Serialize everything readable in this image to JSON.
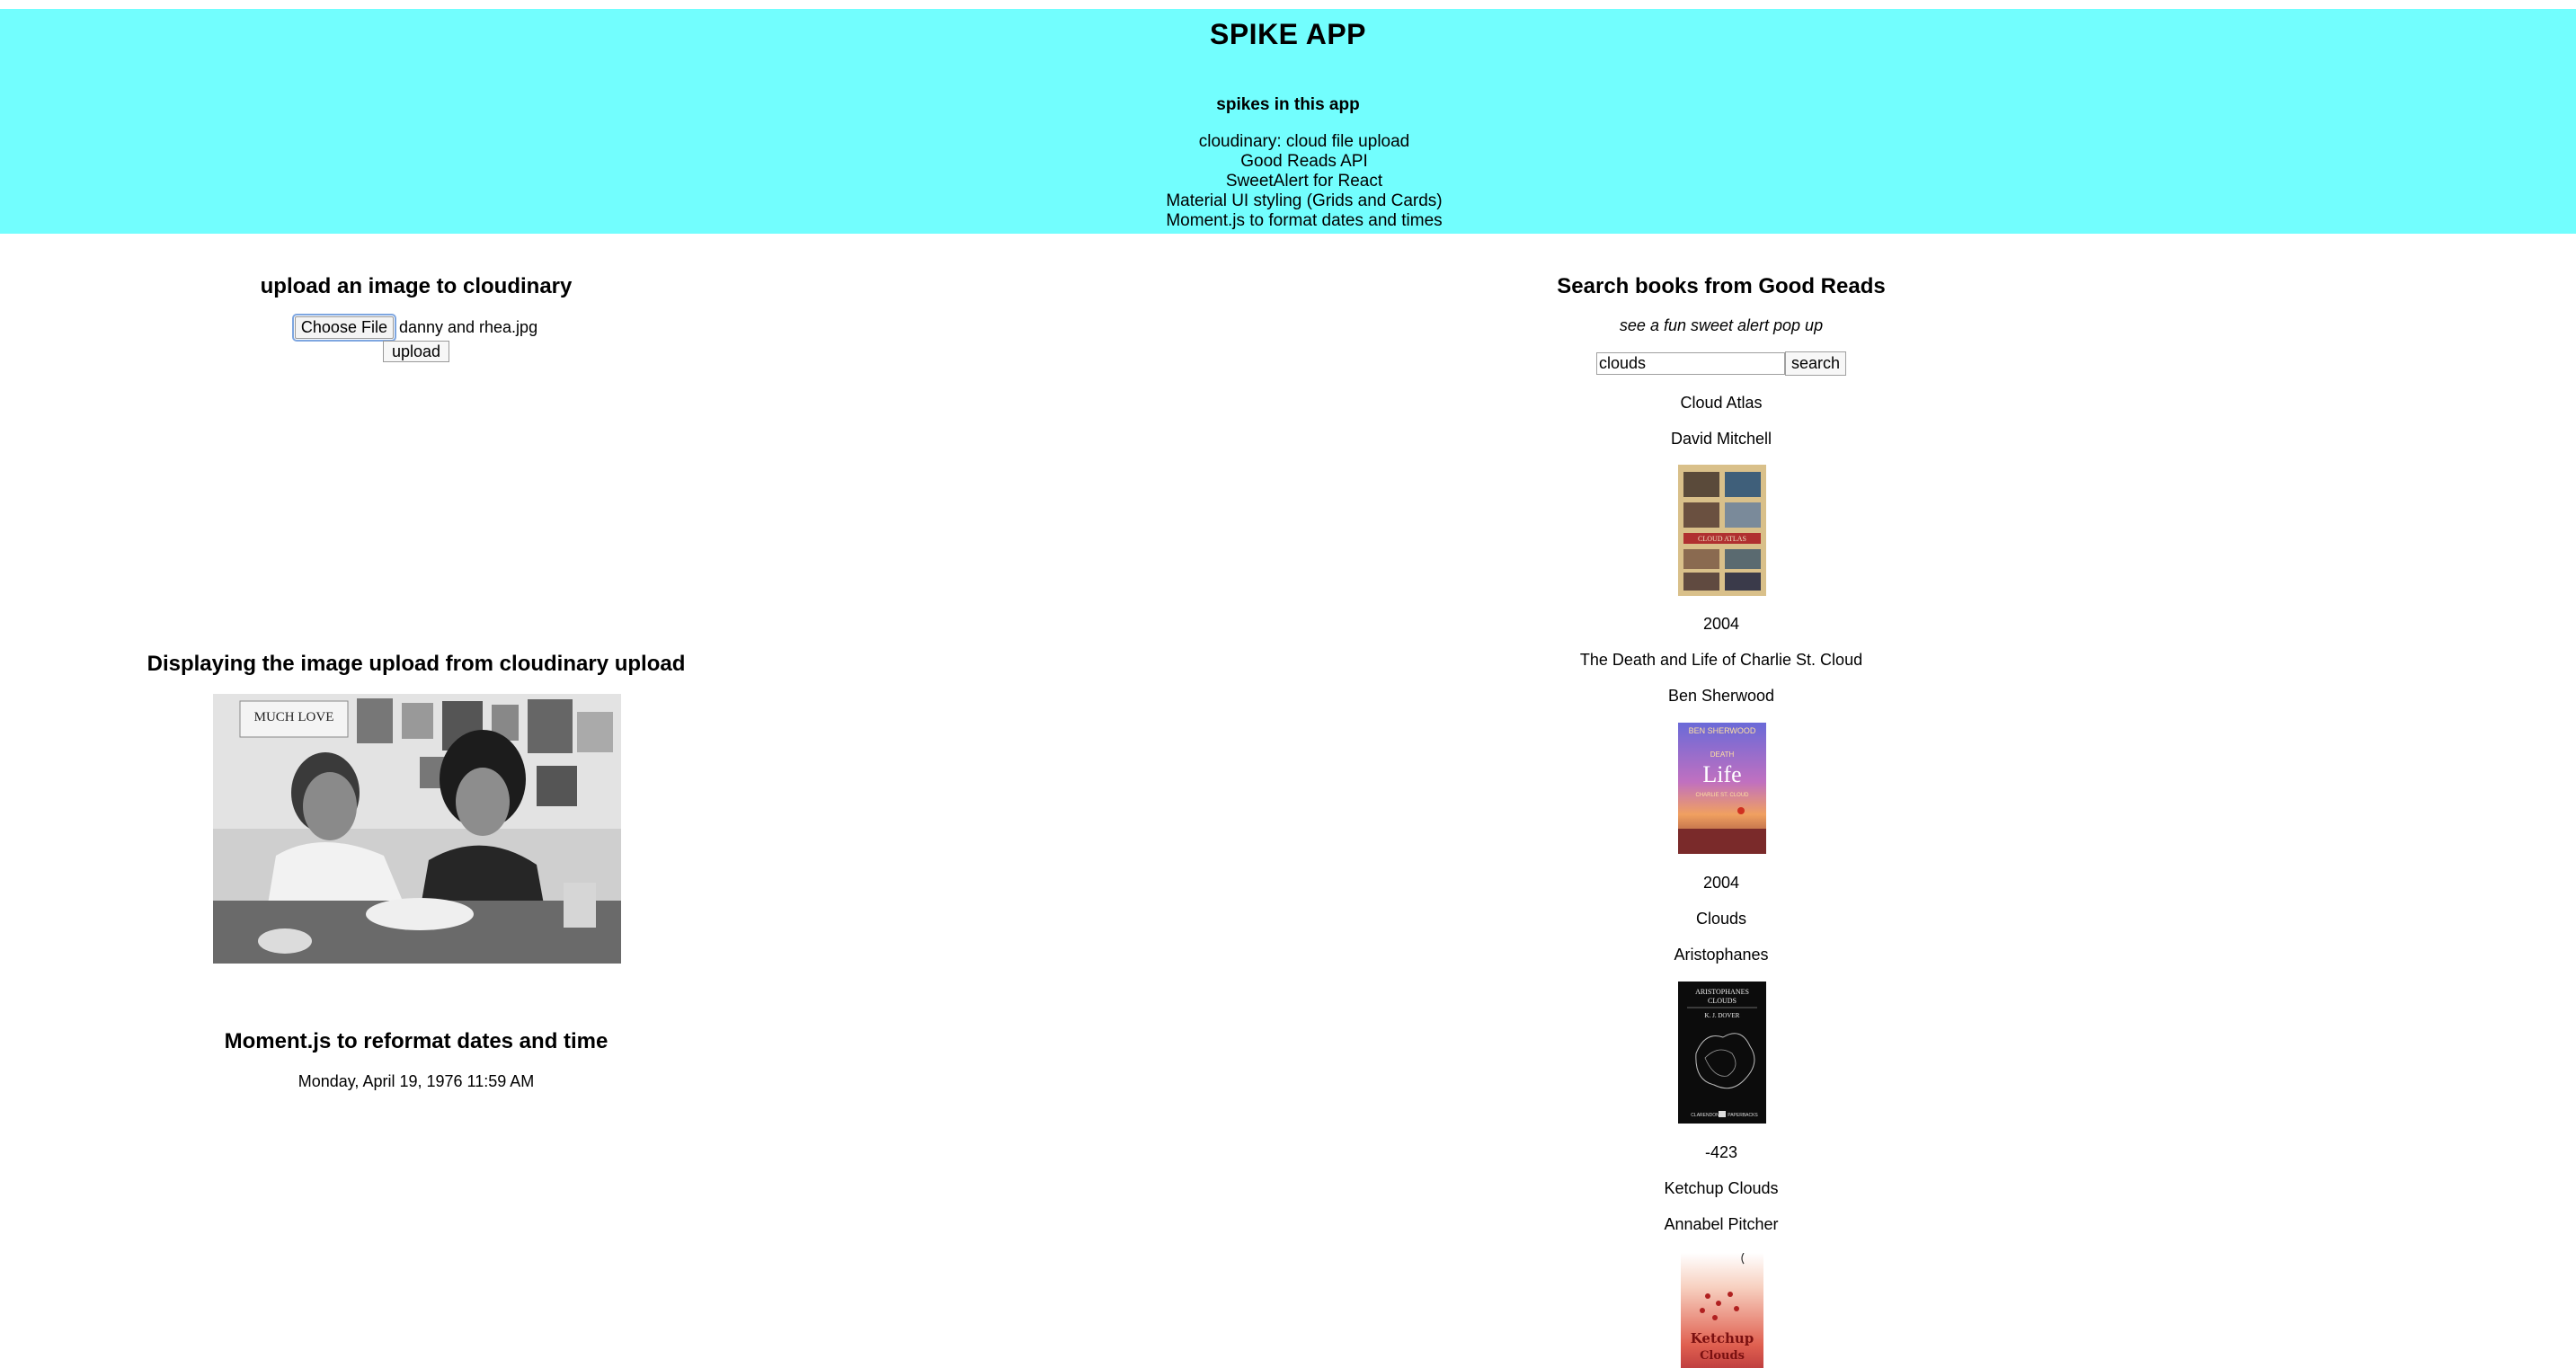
{
  "header": {
    "title": "SPIKE APP",
    "spikes_heading": "spikes in this app",
    "spikes": [
      "cloudinary: cloud file upload",
      "Good Reads API",
      "SweetAlert for React",
      "Material UI styling (Grids and Cards)",
      "Moment.js to format dates and times"
    ]
  },
  "upload": {
    "heading": "upload an image to cloudinary",
    "choose_file_label": "Choose File",
    "file_name": "danny and rhea.jpg",
    "upload_label": "upload"
  },
  "display": {
    "heading": "Displaying the image upload from cloudinary upload",
    "photo_sign_text": "MUCH LOVE"
  },
  "moment": {
    "heading": "Moment.js to reformat dates and time",
    "date": "Monday, April 19, 1976 11:59 AM"
  },
  "search": {
    "heading": "Search books from Good Reads",
    "subtitle": "see a fun sweet alert pop up",
    "query": "clouds",
    "button_label": "search"
  },
  "books": [
    {
      "title": "Cloud Atlas",
      "author": "David Mitchell",
      "year": "2004",
      "cover_text": "CLOUD ATLAS"
    },
    {
      "title": "The Death and Life of Charlie St. Cloud",
      "author": "Ben Sherwood",
      "year": "2004",
      "cover_text": [
        "BEN SHERWOOD",
        "DEATH",
        "Life",
        "CHARLIE ST. CLOUD"
      ]
    },
    {
      "title": "Clouds",
      "author": "Aristophanes",
      "year": "-423",
      "cover_text": [
        "ARISTOPHANES",
        "CLOUDS",
        "K. J. DOVER",
        "CLARENDON",
        "PAPERBACKS"
      ]
    },
    {
      "title": "Ketchup Clouds",
      "author": "Annabel Pitcher",
      "year": "",
      "cover_text": [
        "Ketchup",
        "Clouds"
      ]
    }
  ],
  "colors": {
    "header_bg": "#72fefe",
    "focus_ring": "#7ea6e0"
  }
}
